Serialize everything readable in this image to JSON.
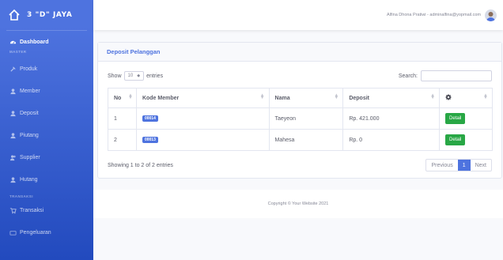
{
  "brand": {
    "name": "3 \"D\" JAYA",
    "icon": "house-icon"
  },
  "sidebar": {
    "dashboard": "Dashboard",
    "heading_master": "MASTER",
    "master_items": [
      "Produk",
      "Member",
      "Deposit",
      "Piutang",
      "Supplier",
      "Hutang"
    ],
    "heading_transaksi": "TRANSAKSI",
    "transaksi_items": [
      "Transaksi",
      "Pengeluaran"
    ]
  },
  "topbar": {
    "user": "Alfina Dhona Pratiwi - adminalfina@yopmail.com"
  },
  "card": {
    "title": "Deposit Pelanggan",
    "show_label": "Show",
    "entries_value": "10",
    "entries_label": "entries",
    "search_label": "Search:",
    "columns": [
      "No",
      "Kode Member",
      "Nama",
      "Deposit"
    ],
    "rows": [
      {
        "no": "1",
        "kode": "00014",
        "nama": "Taeyeon",
        "deposit": "Rp. 421.000",
        "action": "Detail"
      },
      {
        "no": "2",
        "kode": "00013",
        "nama": "Mahesa",
        "deposit": "Rp. 0",
        "action": "Detail"
      }
    ],
    "info": "Showing 1 to 2 of 2 entries",
    "pagination": {
      "previous": "Previous",
      "current": "1",
      "next": "Next"
    }
  },
  "footer": {
    "copyright": "Copyright © Your Website 2021"
  },
  "colors": {
    "primary": "#4e73df",
    "success": "#28a745"
  }
}
